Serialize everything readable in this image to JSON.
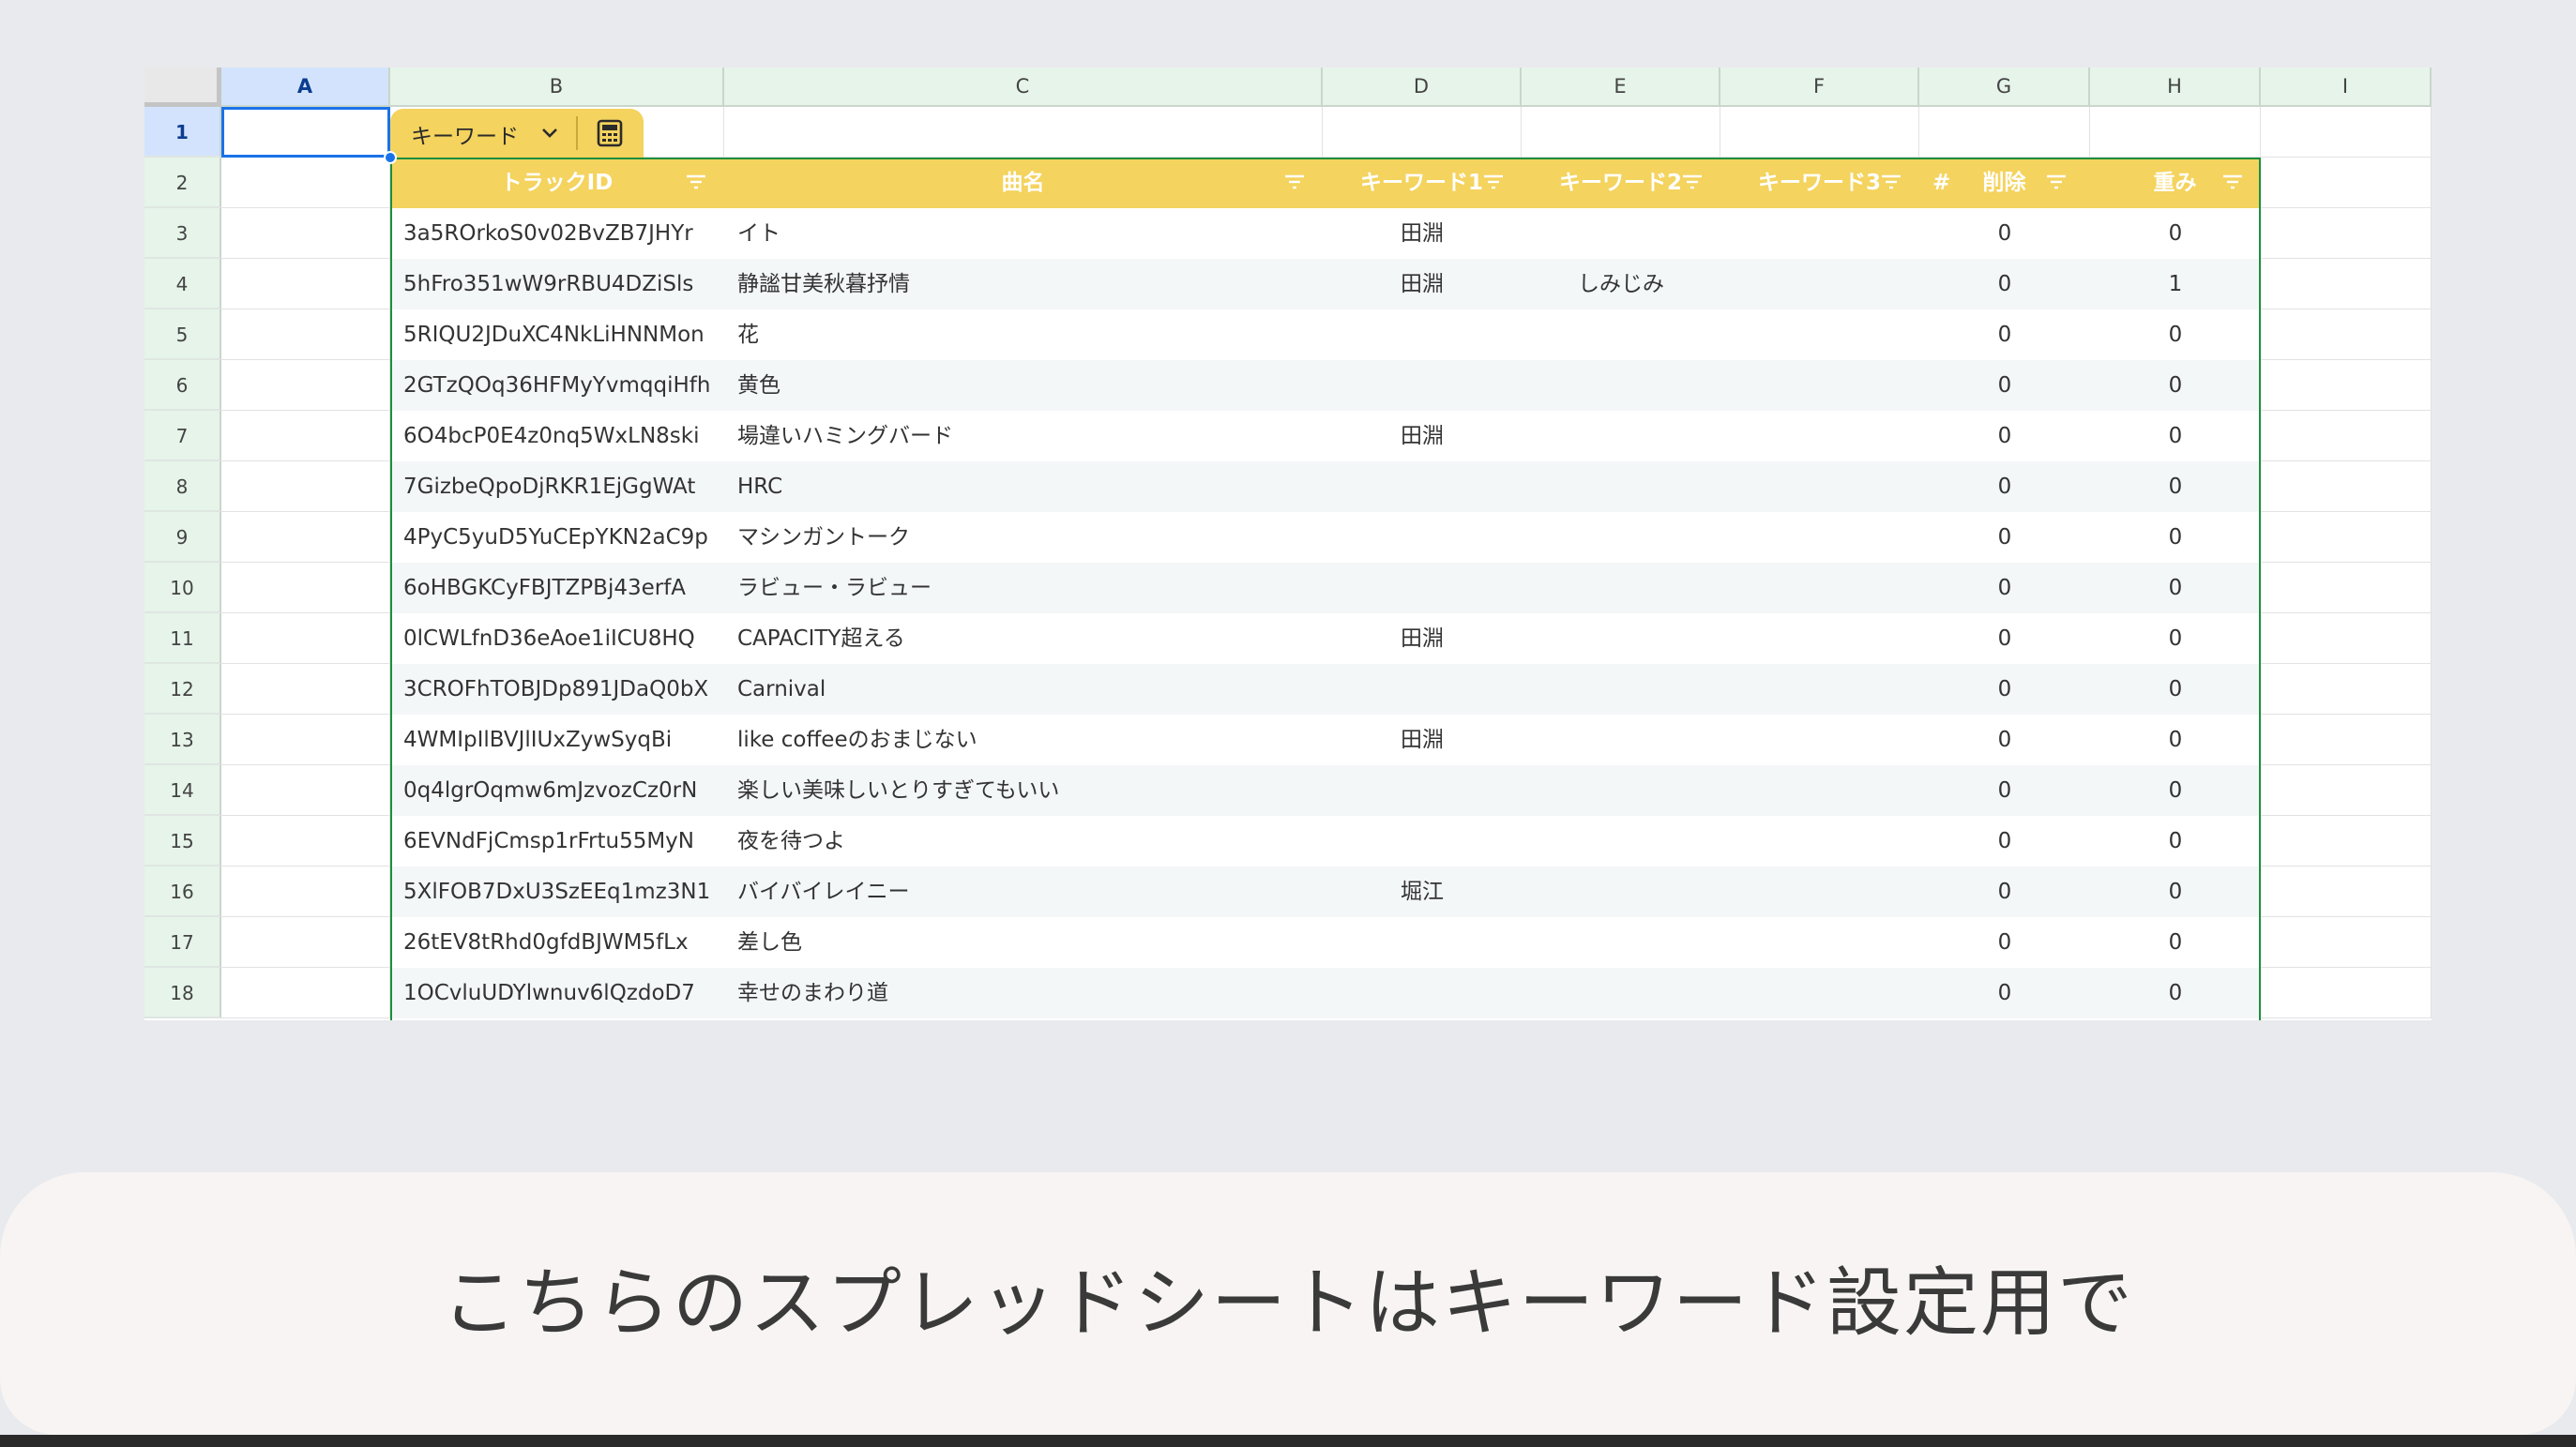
{
  "columns": [
    "A",
    "B",
    "C",
    "D",
    "E",
    "F",
    "G",
    "H",
    "I"
  ],
  "rows": [
    "1",
    "2",
    "3",
    "4",
    "5",
    "6",
    "7",
    "8",
    "9",
    "10",
    "11",
    "12",
    "13",
    "14",
    "15",
    "16",
    "17",
    "18"
  ],
  "table": {
    "name": "キーワード",
    "headers": [
      "トラックID",
      "曲名",
      "キーワード1",
      "キーワード2",
      "キーワード3",
      "削除",
      "重み"
    ],
    "type_marker": "#",
    "rows": [
      {
        "track_id": "3a5ROrkoS0v02BvZB7JHYr",
        "title": "イト",
        "kw1": "田淵",
        "kw2": "",
        "kw3": "",
        "delete": "0",
        "weight": "0"
      },
      {
        "track_id": "5hFro351wW9rRBU4DZiSls",
        "title": "静謐甘美秋暮抒情",
        "kw1": "田淵",
        "kw2": "しみじみ",
        "kw3": "",
        "delete": "0",
        "weight": "1"
      },
      {
        "track_id": "5RIQU2JDuXC4NkLiHNNMon",
        "title": "花",
        "kw1": "",
        "kw2": "",
        "kw3": "",
        "delete": "0",
        "weight": "0"
      },
      {
        "track_id": "2GTzQOq36HFMyYvmqqiHfh",
        "title": "黄色",
        "kw1": "",
        "kw2": "",
        "kw3": "",
        "delete": "0",
        "weight": "0"
      },
      {
        "track_id": "6O4bcP0E4z0nq5WxLN8ski",
        "title": "場違いハミングバード",
        "kw1": "田淵",
        "kw2": "",
        "kw3": "",
        "delete": "0",
        "weight": "0"
      },
      {
        "track_id": "7GizbeQpoDjRKR1EjGgWAt",
        "title": "HRC",
        "kw1": "",
        "kw2": "",
        "kw3": "",
        "delete": "0",
        "weight": "0"
      },
      {
        "track_id": "4PyC5yuD5YuCEpYKN2aC9p",
        "title": "マシンガントーク",
        "kw1": "",
        "kw2": "",
        "kw3": "",
        "delete": "0",
        "weight": "0"
      },
      {
        "track_id": "6oHBGKCyFBJTZPBj43erfA",
        "title": "ラビュー・ラビュー",
        "kw1": "",
        "kw2": "",
        "kw3": "",
        "delete": "0",
        "weight": "0"
      },
      {
        "track_id": "0lCWLfnD36eAoe1iICU8HQ",
        "title": "CAPACITY超える",
        "kw1": "田淵",
        "kw2": "",
        "kw3": "",
        "delete": "0",
        "weight": "0"
      },
      {
        "track_id": "3CROFhTOBJDp891JDaQ0bX",
        "title": "Carnival",
        "kw1": "",
        "kw2": "",
        "kw3": "",
        "delete": "0",
        "weight": "0"
      },
      {
        "track_id": "4WMIpIlBVJlIUxZywSyqBi",
        "title": "like coffeeのおまじない",
        "kw1": "田淵",
        "kw2": "",
        "kw3": "",
        "delete": "0",
        "weight": "0"
      },
      {
        "track_id": "0q4lgrOqmw6mJzvozCz0rN",
        "title": "楽しい美味しいとりすぎてもいい",
        "kw1": "",
        "kw2": "",
        "kw3": "",
        "delete": "0",
        "weight": "0"
      },
      {
        "track_id": "6EVNdFjCmsp1rFrtu55MyN",
        "title": "夜を待つよ",
        "kw1": "",
        "kw2": "",
        "kw3": "",
        "delete": "0",
        "weight": "0"
      },
      {
        "track_id": "5XlFOB7DxU3SzEEq1mz3N1",
        "title": "バイバイレイニー",
        "kw1": "堀江",
        "kw2": "",
        "kw3": "",
        "delete": "0",
        "weight": "0"
      },
      {
        "track_id": "26tEV8tRhd0gfdBJWM5fLx",
        "title": "差し色",
        "kw1": "",
        "kw2": "",
        "kw3": "",
        "delete": "0",
        "weight": "0"
      },
      {
        "track_id": "1OCvluUDYlwnuv6lQzdoD7",
        "title": "幸せのまわり道",
        "kw1": "",
        "kw2": "",
        "kw3": "",
        "delete": "0",
        "weight": "0"
      }
    ]
  },
  "caption": "こちらのスプレッドシートはキーワード設定用で",
  "colors": {
    "table_header": "#f4d35e",
    "table_border": "#1e8e3e",
    "selection": "#1a73e8",
    "header_bg": "#e6f4ea"
  }
}
